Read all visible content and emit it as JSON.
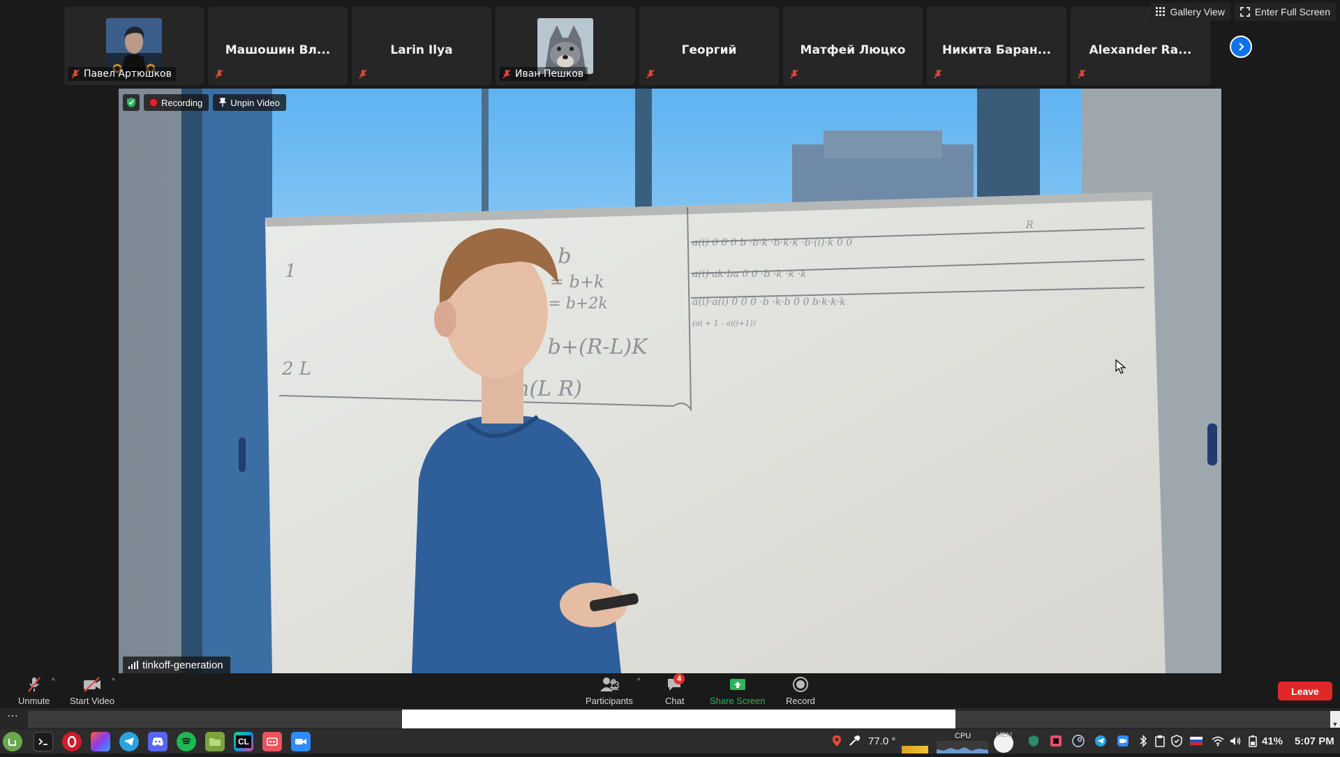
{
  "view_controls": {
    "gallery_view": "Gallery View",
    "enter_full_screen": "Enter Full Screen"
  },
  "participants_strip": [
    {
      "name": "Павел Артюшков",
      "has_avatar": true,
      "muted": true
    },
    {
      "name": "Машошин Вл...",
      "has_avatar": false,
      "muted": true
    },
    {
      "name": "Larin Ilya",
      "has_avatar": false,
      "muted": true
    },
    {
      "name": "Иван Пешков",
      "has_avatar": true,
      "muted": true
    },
    {
      "name": "Георгий",
      "has_avatar": false,
      "muted": true
    },
    {
      "name": "Матфей Люцко",
      "has_avatar": false,
      "muted": true
    },
    {
      "name": "Никита Баран...",
      "has_avatar": false,
      "muted": true
    },
    {
      "name": "Alexander Ra...",
      "has_avatar": false,
      "muted": true
    }
  ],
  "video": {
    "recording_label": "Recording",
    "unpin_label": "Unpin Video",
    "speaker_name": "tinkoff-generation"
  },
  "toolbar": {
    "unmute": "Unmute",
    "start_video": "Start Video",
    "participants": "Participants",
    "participants_count": "13",
    "chat": "Chat",
    "chat_unread": "4",
    "share_screen": "Share Screen",
    "record": "Record",
    "leave": "Leave"
  },
  "panel": {
    "more": "⋯",
    "taskbar_apps": [
      "mint-menu",
      "terminal",
      "opera",
      "jetbrains-toolbox",
      "telegram",
      "discord",
      "spotify",
      "files",
      "clion",
      "app-gallery",
      "zoom"
    ],
    "clion_label": "CL",
    "temperature": "77.0 °",
    "cpu_label": "CPU",
    "mem_label": "MEM",
    "battery": "41%",
    "time": "5:07 PM"
  },
  "colors": {
    "accent_blue": "#0e72ed",
    "leave_red": "#e02828",
    "share_green": "#2fb35b",
    "muted_red": "#e04a3a"
  }
}
